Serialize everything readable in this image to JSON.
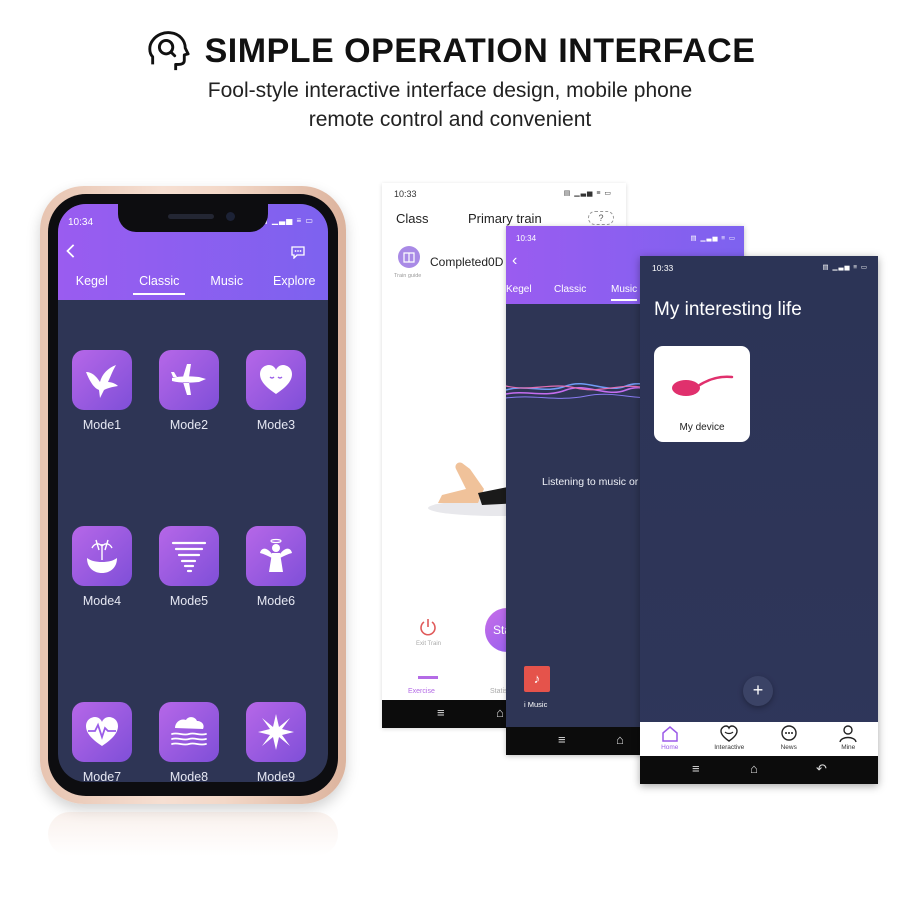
{
  "header": {
    "title": "SIMPLE OPERATION INTERFACE",
    "subtitle_line1": "Fool-style interactive interface design, mobile phone",
    "subtitle_line2": "remote control and convenient",
    "icon": "head-search-icon"
  },
  "phone": {
    "time": "10:34",
    "status": "▤ ▁▃▅ ≡ ▭",
    "tabs": [
      {
        "label": "Kegel",
        "active": false
      },
      {
        "label": "Classic",
        "active": true
      },
      {
        "label": "Music",
        "active": false
      },
      {
        "label": "Explore",
        "active": false
      }
    ],
    "modes": [
      {
        "label": "Mode1",
        "icon": "bird-icon"
      },
      {
        "label": "Mode2",
        "icon": "airplane-icon"
      },
      {
        "label": "Mode3",
        "icon": "heart-icon"
      },
      {
        "label": "Mode4",
        "icon": "fountain-icon"
      },
      {
        "label": "Mode5",
        "icon": "tornado-icon"
      },
      {
        "label": "Mode6",
        "icon": "angel-icon"
      },
      {
        "label": "Mode7",
        "icon": "heartbeat-icon"
      },
      {
        "label": "Mode8",
        "icon": "wave-icon"
      },
      {
        "label": "Mode9",
        "icon": "star-icon"
      }
    ],
    "accent_color": "#8a5cf0",
    "background_color": "#2e3555"
  },
  "screen_train": {
    "time": "10:33",
    "tabs": [
      "Class",
      "Primary train"
    ],
    "help": "?",
    "book_label": "Train guide",
    "completed": "Completed0D",
    "exit_label": "Exit Train",
    "start_label": "Sta",
    "bottom": [
      "Exercise",
      "Statis"
    ]
  },
  "screen_music": {
    "time": "10:34",
    "tabs": [
      "Kegel",
      "Classic",
      "Music"
    ],
    "listening": "Listening to music or",
    "music_label": "i Music"
  },
  "screen_home": {
    "time": "10:33",
    "title": "My interesting life",
    "device_label": "My device",
    "add": "+",
    "nav": [
      {
        "label": "Home",
        "icon": "home-icon",
        "active": true
      },
      {
        "label": "Interactive",
        "icon": "interactive-heart-icon",
        "active": false
      },
      {
        "label": "News",
        "icon": "chat-bubble-icon",
        "active": false
      },
      {
        "label": "Mine",
        "icon": "user-icon",
        "active": false
      }
    ]
  }
}
